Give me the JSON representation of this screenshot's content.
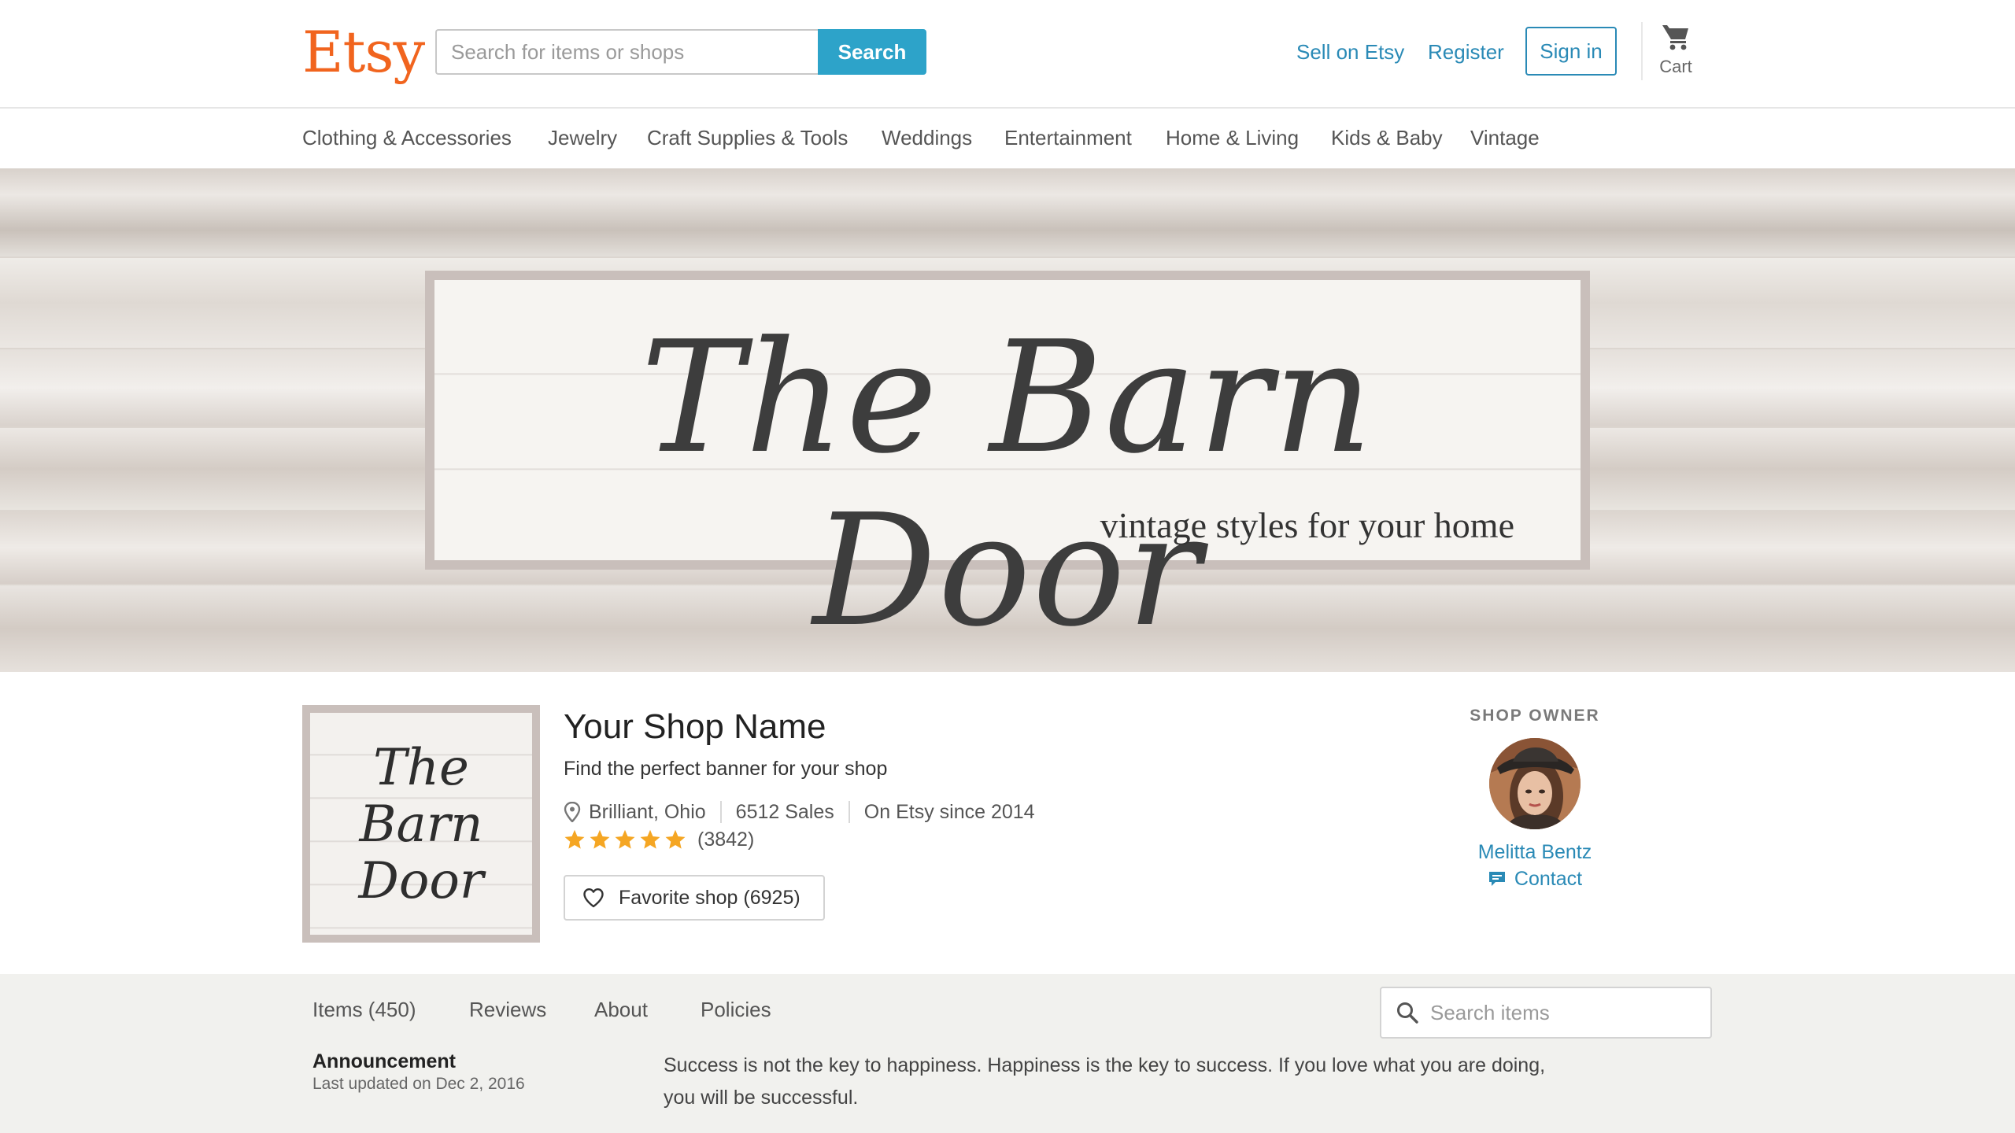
{
  "header": {
    "logo": "Etsy",
    "search_placeholder": "Search for items or shops",
    "search_button": "Search",
    "sell_link": "Sell on Etsy",
    "register_link": "Register",
    "signin_button": "Sign in",
    "cart_label": "Cart"
  },
  "categories": [
    "Clothing & Accessories",
    "Jewelry",
    "Craft Supplies & Tools",
    "Weddings",
    "Entertainment",
    "Home & Living",
    "Kids & Baby",
    "Vintage"
  ],
  "banner": {
    "title": "The Barn Door",
    "tagline": "vintage styles for your home"
  },
  "shop": {
    "logo_lines": [
      "The",
      "Barn",
      "Door"
    ],
    "name": "Your Shop Name",
    "tagline": "Find the perfect banner for your shop",
    "location": "Brilliant, Ohio",
    "sales": "6512 Sales",
    "since": "On Etsy since 2014",
    "rating_stars": 5,
    "rating_count": "(3842)",
    "favorite_button": "Favorite shop (6925)"
  },
  "owner": {
    "heading": "SHOP OWNER",
    "name": "Melitta Bentz",
    "contact": "Contact"
  },
  "tabs": [
    "Items (450)",
    "Reviews",
    "About",
    "Policies"
  ],
  "items_search_placeholder": "Search items",
  "announcement": {
    "title": "Announcement",
    "updated": "Last updated on Dec 2, 2016",
    "text": "Success is not the key to happiness. Happiness is the key to success. If you love what you are doing, you will be successful."
  },
  "colors": {
    "brand_orange": "#f1641e",
    "link_blue": "#2a8ab6",
    "search_button": "#2da3c9",
    "star_orange": "#f5a623"
  }
}
